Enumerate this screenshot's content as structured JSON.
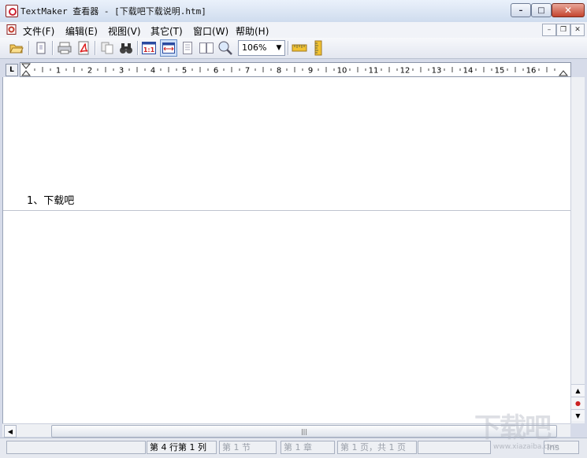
{
  "window": {
    "title": "TextMaker 查看器 - [下载吧下载说明.htm]",
    "controls": {
      "minimize": "–",
      "maximize": "□",
      "close": "✕"
    }
  },
  "menu": {
    "items": [
      "文件(F)",
      "编辑(E)",
      "视图(V)",
      "其它(T)",
      "窗口(W)",
      "帮助(H)"
    ],
    "mdi_controls": {
      "minimize": "–",
      "restore": "❐",
      "close": "✕"
    }
  },
  "toolbar": {
    "buttons": [
      "open-folder",
      "new-page",
      "print",
      "export-pdf",
      "copy",
      "find",
      "actual-size",
      "fit-width",
      "full-page",
      "two-pages",
      "zoom"
    ],
    "zoom_value": "106%",
    "zoom_arrow": "▼"
  },
  "ruler": {
    "corner": "L",
    "labels": [
      "1",
      "2",
      "3",
      "4",
      "5",
      "6",
      "7",
      "8",
      "9",
      "10",
      "11",
      "12",
      "13",
      "14",
      "15",
      "16"
    ]
  },
  "document": {
    "text": "1、下载吧"
  },
  "scrollbar": {
    "up": "▲",
    "marker": "●",
    "down": "▼",
    "left": "◀",
    "grip": "|||"
  },
  "status": {
    "position": "第 4 行第 1 列",
    "section": "第 1 节",
    "chapter": "第 1 章",
    "page": "第 1 页，共 1 页",
    "mode": "Ins"
  },
  "watermark": {
    "text": "下载吧",
    "url": "www.xiazaiba.com"
  },
  "colors": {
    "accent": "#c23a2b",
    "window_bg": "#d6dbe9"
  }
}
